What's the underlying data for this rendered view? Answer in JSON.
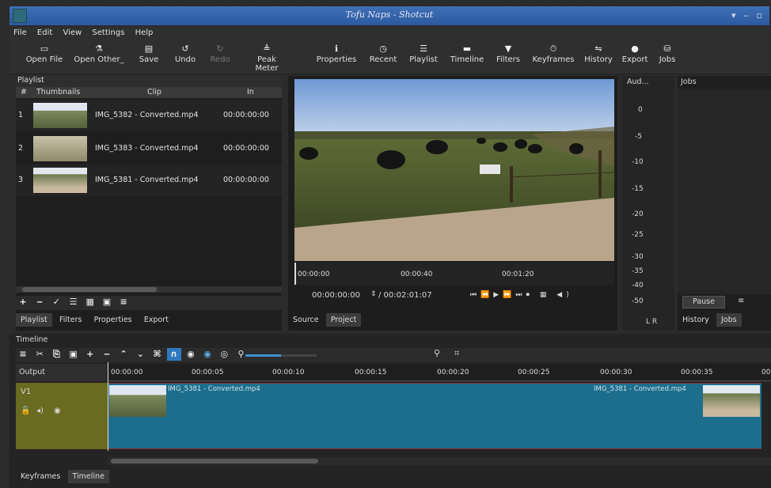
{
  "window": {
    "title": "Tofu Naps - Shotcut",
    "controls": "▾ ‒ ▫"
  },
  "menu": [
    "File",
    "Edit",
    "View",
    "Settings",
    "Help"
  ],
  "toolbar": [
    {
      "label": "Open File",
      "icon": "folder-open-icon",
      "glyph": "▭"
    },
    {
      "label": "Open Other_",
      "icon": "open-other-icon",
      "glyph": "⚗"
    },
    {
      "label": "Save",
      "icon": "save-icon",
      "glyph": "▤"
    },
    {
      "label": "Undo",
      "icon": "undo-icon",
      "glyph": "↺"
    },
    {
      "label": "Redo",
      "icon": "redo-icon",
      "glyph": "↻",
      "disabled": true
    },
    {
      "label": "Peak Meter",
      "icon": "peak-meter-icon",
      "glyph": "≜"
    },
    {
      "label": "Properties",
      "icon": "info-icon",
      "glyph": "ℹ"
    },
    {
      "label": "Recent",
      "icon": "clock-icon",
      "glyph": "◷"
    },
    {
      "label": "Playlist",
      "icon": "list-icon",
      "glyph": "☰"
    },
    {
      "label": "Timeline",
      "icon": "timeline-icon",
      "glyph": "▬"
    },
    {
      "label": "Filters",
      "icon": "filter-icon",
      "glyph": "▼"
    },
    {
      "label": "Keyframes",
      "icon": "stopwatch-icon",
      "glyph": "⏱"
    },
    {
      "label": "History",
      "icon": "history-icon",
      "glyph": "⇋"
    },
    {
      "label": "Export",
      "icon": "export-icon",
      "glyph": "●"
    },
    {
      "label": "Jobs",
      "icon": "jobs-icon",
      "glyph": "⛁"
    }
  ],
  "playlist": {
    "title": "Playlist",
    "columns": [
      "#",
      "Thumbnails",
      "Clip",
      "In"
    ],
    "rows": [
      {
        "num": "1",
        "clip": "IMG_5382 - Converted.mp4",
        "in": "00:00:00:00"
      },
      {
        "num": "2",
        "clip": "IMG_5383 - Converted.mp4",
        "in": "00:00:00:00"
      },
      {
        "num": "3",
        "clip": "IMG_5381 - Converted.mp4",
        "in": "00:00:00:00"
      }
    ],
    "tabs": [
      "Playlist",
      "Filters",
      "Properties",
      "Export"
    ]
  },
  "player": {
    "ruler": [
      "00:00:00",
      "00:00:40",
      "00:01:20"
    ],
    "current_time": "00:00:00:00",
    "duration": "/ 00:02:01:07",
    "tabs": [
      "Source",
      "Project"
    ]
  },
  "audio": {
    "title": "Aud...",
    "scale": [
      "0",
      "-5",
      "-10",
      "-15",
      "-20",
      "-25",
      "-30",
      "-35",
      "-40",
      "-50"
    ],
    "channels": "L R"
  },
  "jobs": {
    "title": "Jobs",
    "pause_label": "Pause",
    "menu_glyph": "≡",
    "tabs": [
      "History",
      "Jobs"
    ]
  },
  "timeline": {
    "title": "Timeline",
    "output_label": "Output",
    "track_name": "V1",
    "ruler": [
      "00:00:00",
      "00:00:05",
      "00:00:10",
      "00:00:15",
      "00:00:20",
      "00:00:25",
      "00:00:30",
      "00:00:35",
      "00"
    ],
    "clip1": "IMG_5381 - Converted.mp4",
    "clip2": "IMG_5381 - Converted.mp4",
    "zoom_level": 0.5
  },
  "bottom_tabs": [
    "Keyframes",
    "Timeline"
  ]
}
